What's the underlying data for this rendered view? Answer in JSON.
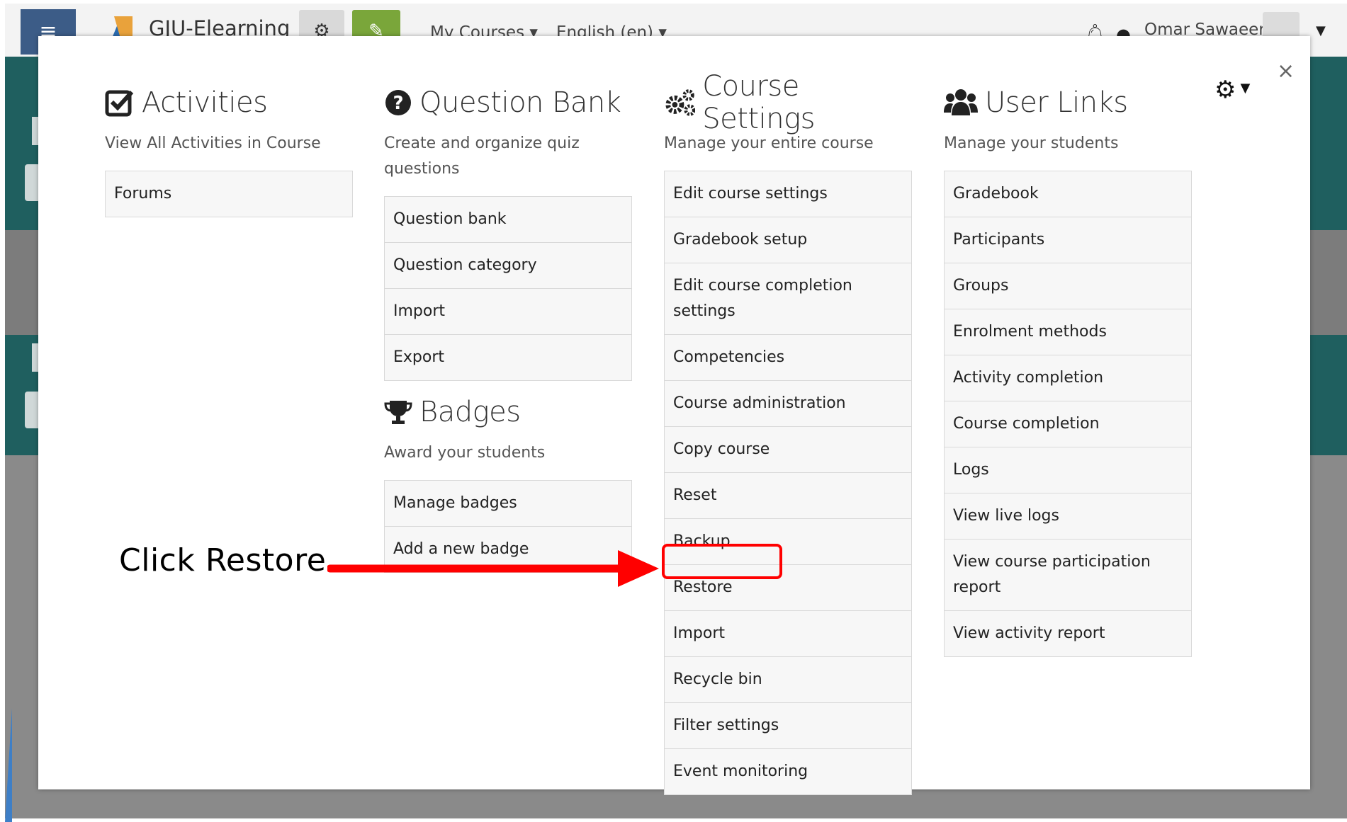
{
  "navbar": {
    "menu_icon": "hamburger-icon",
    "site_name": "GJU-Elearning",
    "menu_courses": "My Courses",
    "menu_language": "English (en)",
    "user_name": "Omar Sawaeer"
  },
  "modal": {
    "close_label": "×",
    "columns": [
      {
        "icon": "check-square-icon",
        "title": "Activities",
        "description": "View All Activities in Course",
        "items": [
          "Forums"
        ]
      },
      {
        "icon": "question-circle-icon",
        "title": "Question Bank",
        "description": "Create and organize quiz questions",
        "items": [
          "Question bank",
          "Question category",
          "Import",
          "Export"
        ]
      },
      {
        "icon": "cogs-icon",
        "title": "Course Settings",
        "description": "Manage your entire course",
        "items": [
          "Edit course settings",
          "Gradebook setup",
          "Edit course completion settings",
          "Competencies",
          "Course administration",
          "Copy course",
          "Reset",
          "Backup",
          "Restore",
          "Import",
          "Recycle bin",
          "Filter settings",
          "Event monitoring"
        ]
      },
      {
        "icon": "users-icon",
        "title": "User Links",
        "description": "Manage your students",
        "items": [
          "Gradebook",
          "Participants",
          "Groups",
          "Enrolment methods",
          "Activity completion",
          "Course completion",
          "Logs",
          "View live logs",
          "View course participation report",
          "View activity report"
        ]
      }
    ],
    "badges": {
      "icon": "trophy-icon",
      "title": "Badges",
      "description": "Award your students",
      "items": [
        "Manage badges",
        "Add a new badge"
      ]
    }
  },
  "annotation": {
    "label": "Click Restore",
    "color": "#ff0000"
  }
}
